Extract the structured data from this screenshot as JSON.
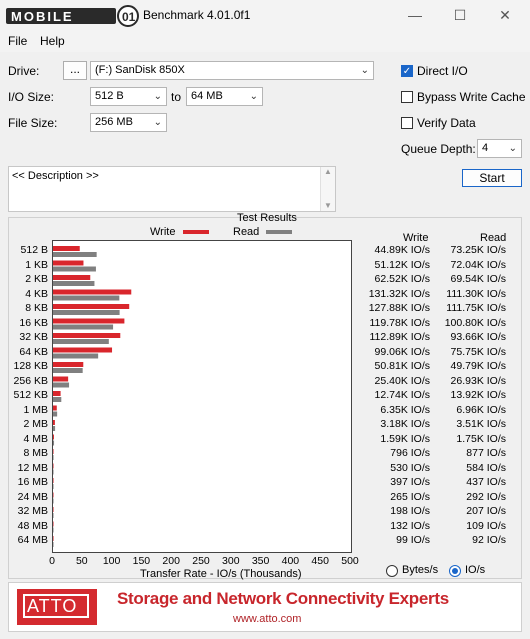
{
  "window": {
    "title": "Benchmark 4.01.0f1",
    "watermark": "MOBILE01"
  },
  "menu": {
    "file": "File",
    "help": "Help"
  },
  "controls": {
    "drive_label": "Drive:",
    "browse_label": "...",
    "drive_value": "(F:) SanDisk 850X",
    "io_size_label": "I/O Size:",
    "io_from": "512 B",
    "io_to_label": "to",
    "io_to": "64 MB",
    "file_size_label": "File Size:",
    "file_size": "256 MB",
    "direct_io_label": "Direct I/O",
    "direct_io_checked": true,
    "bypass_cache_label": "Bypass Write Cache",
    "bypass_cache_checked": false,
    "verify_label": "Verify Data",
    "verify_checked": false,
    "queue_label": "Queue Depth:",
    "queue_value": "4",
    "start_label": "Start",
    "description": "<< Description >>"
  },
  "results": {
    "title": "Test Results",
    "write_legend": "Write",
    "read_legend": "Read",
    "write_header": "Write",
    "read_header": "Read",
    "x_axis_label": "Transfer Rate - IO/s (Thousands)",
    "x_ticks": [
      "0",
      "50",
      "100",
      "150",
      "200",
      "250",
      "300",
      "350",
      "400",
      "450",
      "500"
    ],
    "write_color": "#d9262c",
    "read_color": "#808080",
    "rows": [
      {
        "size": "512 B",
        "write": "44.89K IO/s",
        "read": "73.25K IO/s"
      },
      {
        "size": "1 KB",
        "write": "51.12K IO/s",
        "read": "72.04K IO/s"
      },
      {
        "size": "2 KB",
        "write": "62.52K IO/s",
        "read": "69.54K IO/s"
      },
      {
        "size": "4 KB",
        "write": "131.32K IO/s",
        "read": "111.30K IO/s"
      },
      {
        "size": "8 KB",
        "write": "127.88K IO/s",
        "read": "111.75K IO/s"
      },
      {
        "size": "16 KB",
        "write": "119.78K IO/s",
        "read": "100.80K IO/s"
      },
      {
        "size": "32 KB",
        "write": "112.89K IO/s",
        "read": "93.66K IO/s"
      },
      {
        "size": "64 KB",
        "write": "99.06K IO/s",
        "read": "75.75K IO/s"
      },
      {
        "size": "128 KB",
        "write": "50.81K IO/s",
        "read": "49.79K IO/s"
      },
      {
        "size": "256 KB",
        "write": "25.40K IO/s",
        "read": "26.93K IO/s"
      },
      {
        "size": "512 KB",
        "write": "12.74K IO/s",
        "read": "13.92K IO/s"
      },
      {
        "size": "1 MB",
        "write": "6.35K IO/s",
        "read": "6.96K IO/s"
      },
      {
        "size": "2 MB",
        "write": "3.18K IO/s",
        "read": "3.51K IO/s"
      },
      {
        "size": "4 MB",
        "write": "1.59K IO/s",
        "read": "1.75K IO/s"
      },
      {
        "size": "8 MB",
        "write": "796 IO/s",
        "read": "877 IO/s"
      },
      {
        "size": "12 MB",
        "write": "530 IO/s",
        "read": "584 IO/s"
      },
      {
        "size": "16 MB",
        "write": "397 IO/s",
        "read": "437 IO/s"
      },
      {
        "size": "24 MB",
        "write": "265 IO/s",
        "read": "292 IO/s"
      },
      {
        "size": "32 MB",
        "write": "198 IO/s",
        "read": "207 IO/s"
      },
      {
        "size": "48 MB",
        "write": "132 IO/s",
        "read": "109 IO/s"
      },
      {
        "size": "64 MB",
        "write": "99 IO/s",
        "read": "92 IO/s"
      }
    ],
    "units_bytes": "Bytes/s",
    "units_io": "IO/s",
    "units_selected": "IO/s"
  },
  "chart_data": {
    "type": "bar",
    "categories": [
      "512 B",
      "1 KB",
      "2 KB",
      "4 KB",
      "8 KB",
      "16 KB",
      "32 KB",
      "64 KB",
      "128 KB",
      "256 KB",
      "512 KB",
      "1 MB",
      "2 MB",
      "4 MB",
      "8 MB",
      "12 MB",
      "16 MB",
      "24 MB",
      "32 MB",
      "48 MB",
      "64 MB"
    ],
    "series": [
      {
        "name": "Write",
        "values": [
          44.89,
          51.12,
          62.52,
          131.32,
          127.88,
          119.78,
          112.89,
          99.06,
          50.81,
          25.4,
          12.74,
          6.35,
          3.18,
          1.59,
          0.796,
          0.53,
          0.397,
          0.265,
          0.198,
          0.132,
          0.099
        ]
      },
      {
        "name": "Read",
        "values": [
          73.25,
          72.04,
          69.54,
          111.3,
          111.75,
          100.8,
          93.66,
          75.75,
          49.79,
          26.93,
          13.92,
          6.96,
          3.51,
          1.75,
          0.877,
          0.584,
          0.437,
          0.292,
          0.207,
          0.109,
          0.092
        ]
      }
    ],
    "title": "Test Results",
    "xlabel": "Transfer Rate - IO/s (Thousands)",
    "xlim": [
      0,
      500
    ],
    "orientation": "horizontal"
  },
  "banner": {
    "logo": "ATTO",
    "tagline": "Storage and Network Connectivity Experts",
    "url": "www.atto.com"
  }
}
